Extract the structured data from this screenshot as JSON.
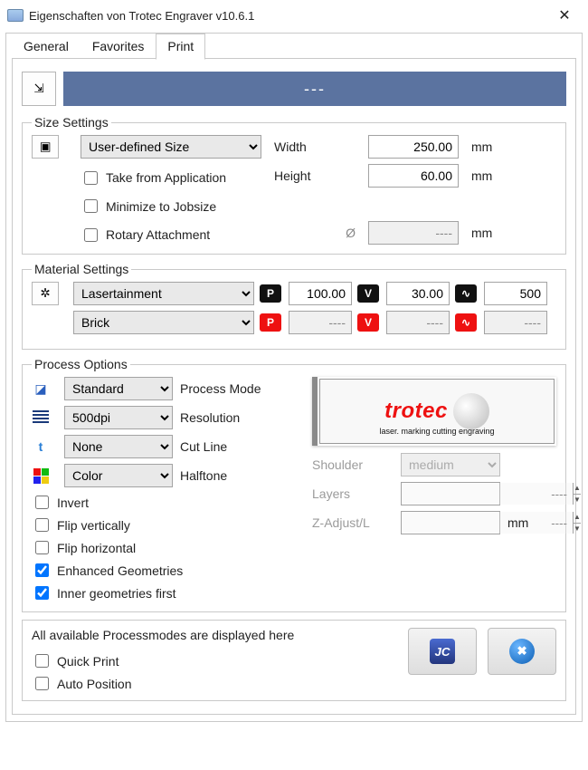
{
  "window": {
    "title": "Eigenschaften von Trotec Engraver v10.6.1"
  },
  "tabs": {
    "general": "General",
    "favorites": "Favorites",
    "print": "Print",
    "active": "print"
  },
  "topbar": {
    "label": "---"
  },
  "size": {
    "legend": "Size Settings",
    "mode": "User-defined Size",
    "width_label": "Width",
    "width_value": "250.00",
    "width_unit": "mm",
    "height_label": "Height",
    "height_value": "60.00",
    "height_unit": "mm",
    "diam_symbol": "Ø",
    "diam_value": "----",
    "diam_unit": "mm",
    "take_from_app": "Take from Application",
    "minimize": "Minimize to Jobsize",
    "rotary": "Rotary Attachment"
  },
  "material": {
    "legend": "Material Settings",
    "row1": {
      "name": "Lasertainment",
      "p": "100.00",
      "v": "30.00",
      "hz": "500"
    },
    "row2": {
      "name": "Brick",
      "p": "----",
      "v": "----",
      "hz": "----"
    }
  },
  "process": {
    "legend": "Process Options",
    "mode": {
      "value": "Standard",
      "label": "Process Mode"
    },
    "res": {
      "value": "500dpi",
      "label": "Resolution"
    },
    "cut": {
      "value": "None",
      "label": "Cut Line"
    },
    "half": {
      "value": "Color",
      "label": "Halftone"
    },
    "invert": "Invert",
    "flipv": "Flip vertically",
    "fliph": "Flip horizontal",
    "enh": "Enhanced Geometries",
    "inner": "Inner geometries first",
    "shoulder_label": "Shoulder",
    "shoulder_value": "medium",
    "layers_label": "Layers",
    "layers_value": "----",
    "zadj_label": "Z-Adjust/L",
    "zadj_value": "----",
    "zadj_unit": "mm",
    "preview_brand": "trotec",
    "preview_tag": "laser. marking cutting engraving"
  },
  "footer": {
    "note": "All available Processmodes are displayed here",
    "quick": "Quick Print",
    "auto": "Auto Position"
  }
}
